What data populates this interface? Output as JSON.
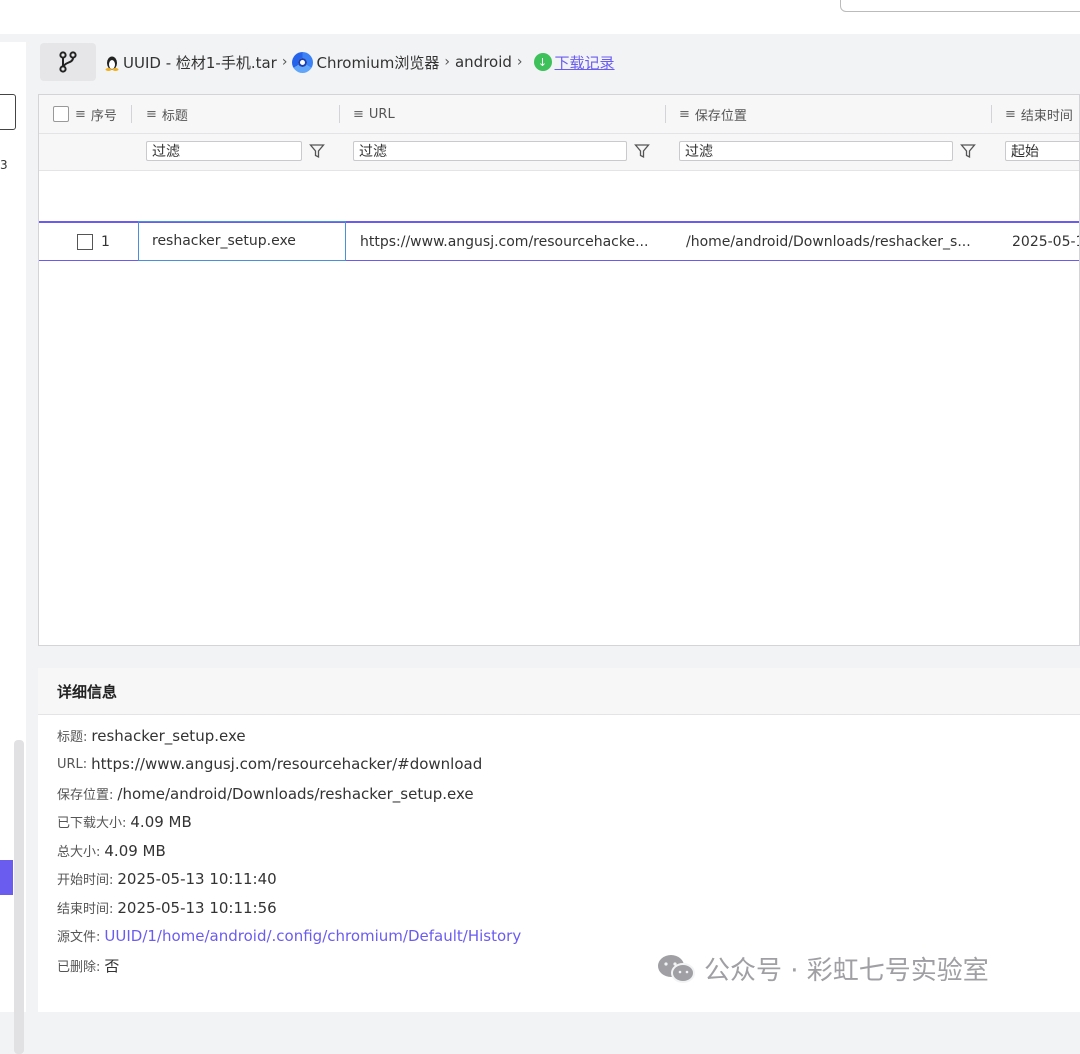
{
  "breadcrumb": {
    "case_file": "UUID - 检材1-手机.tar",
    "browser": "Chromium浏览器",
    "profile": "android",
    "current": "下载记录"
  },
  "table": {
    "columns": {
      "index": "序号",
      "title": "标题",
      "url": "URL",
      "save_path": "保存位置",
      "end_time": "结束时间"
    },
    "filters": {
      "title_placeholder": "过滤",
      "url_placeholder": "过滤",
      "path_placeholder": "过滤",
      "time_placeholder": "起始"
    },
    "rows": [
      {
        "index": "1",
        "title": "reshacker_setup.exe",
        "url": "https://www.angusj.com/resourcehacke...",
        "save_path": "/home/android/Downloads/reshacker_s...",
        "end_time": "2025-05-1"
      }
    ]
  },
  "detail": {
    "header": "详细信息",
    "title_label": "标题:",
    "title_value": "reshacker_setup.exe",
    "url_label": "URL:",
    "url_value": "https://www.angusj.com/resourcehacker/#download",
    "path_label": "保存位置:",
    "path_value": "/home/android/Downloads/reshacker_setup.exe",
    "downloaded_label": "已下载大小:",
    "downloaded_value": "4.09 MB",
    "total_label": "总大小:",
    "total_value": "4.09 MB",
    "start_label": "开始时间:",
    "start_value": "2025-05-13 10:11:40",
    "end_label": "结束时间:",
    "end_value": "2025-05-13 10:11:56",
    "source_label": "源文件:",
    "source_value": "UUID/1/home/android/.config/chromium/Default/History",
    "deleted_label": "已删除:",
    "deleted_value": "否"
  },
  "left_strip": {
    "char": "3"
  },
  "watermark": {
    "text": "公众号 · 彩虹七号实验室"
  },
  "colors": {
    "accent": "#6b5cf0",
    "focus": "#4a8fd9",
    "download_green": "#3ec05a"
  }
}
